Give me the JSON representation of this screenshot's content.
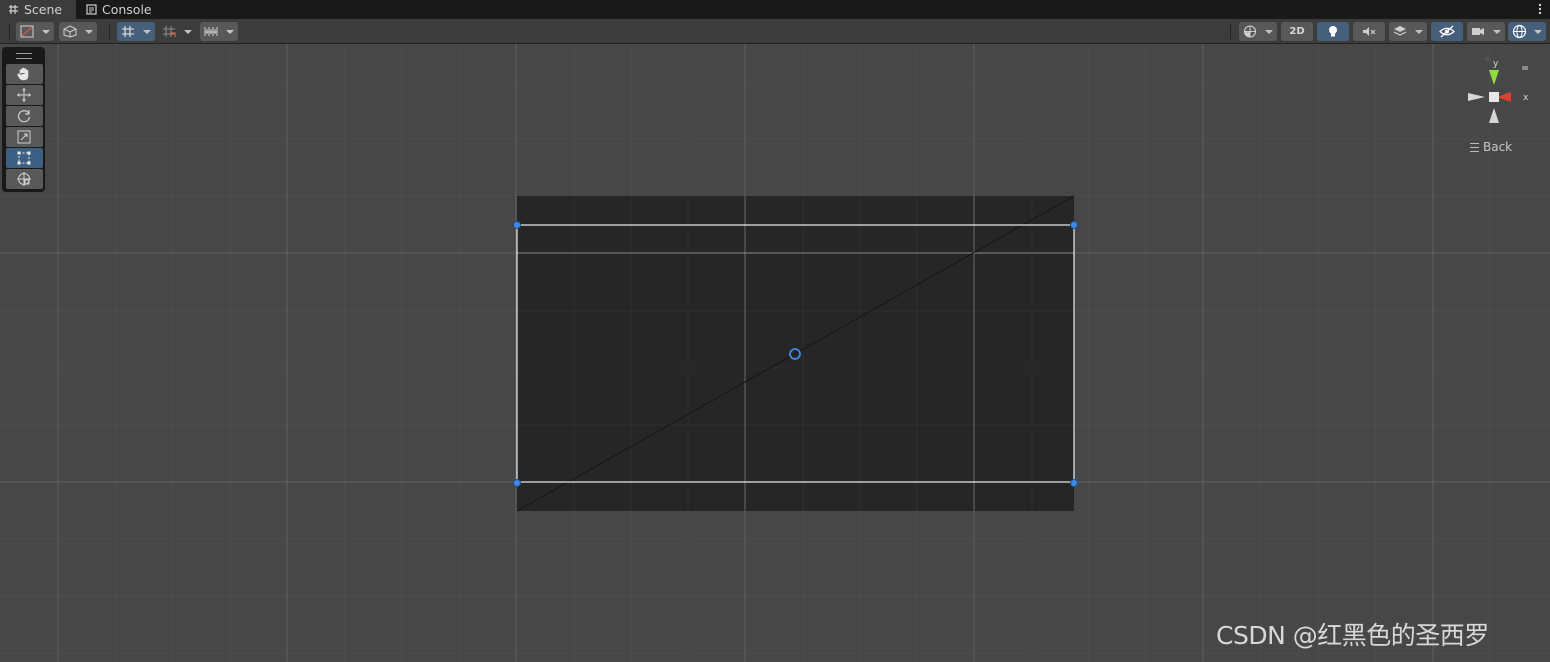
{
  "tabs": [
    {
      "label": "Scene",
      "icon": "grid-icon",
      "active": true
    },
    {
      "label": "Console",
      "icon": "console-icon",
      "active": false
    }
  ],
  "toolbar": {
    "left": [
      {
        "icon": "draw-mode-icon",
        "dropdown": true
      },
      {
        "icon": "cube-icon",
        "dropdown": true
      },
      {
        "icon": "grid-snap-icon",
        "dropdown": true,
        "active": true
      },
      {
        "icon": "increment-snap-icon",
        "dropdown": true
      },
      {
        "icon": "ruler-icon",
        "dropdown": true
      }
    ],
    "right": [
      {
        "icon": "shading-sphere-icon",
        "dropdown": true
      },
      {
        "label": "2D",
        "active": false
      },
      {
        "icon": "lightbulb-icon",
        "active": true
      },
      {
        "icon": "audio-mute-icon"
      },
      {
        "icon": "effects-layers-icon",
        "dropdown": true
      },
      {
        "icon": "hidden-eye-icon",
        "active": true
      },
      {
        "icon": "camera-icon",
        "dropdown": true
      },
      {
        "icon": "gizmos-globe-icon",
        "dropdown": true,
        "active": true
      }
    ]
  },
  "tools": [
    {
      "name": "hand-tool",
      "icon": "hand-icon"
    },
    {
      "name": "move-tool",
      "icon": "move-arrows-icon"
    },
    {
      "name": "rotate-tool",
      "icon": "rotate-icon"
    },
    {
      "name": "scale-tool",
      "icon": "scale-icon"
    },
    {
      "name": "rect-tool",
      "icon": "rect-transform-icon",
      "active": true
    },
    {
      "name": "transform-tool",
      "icon": "transform-icon"
    }
  ],
  "gizmo": {
    "y_label": "y",
    "x_label": "x",
    "view_label": "Back",
    "colors": {
      "y_axis": "#8fdc3c",
      "x_axis": "#e0412e"
    }
  },
  "scene": {
    "grid_color": "#5a5a5a",
    "rect_handle_color": "#3d8ae8"
  },
  "watermark": "CSDN @红黑色的圣西罗"
}
